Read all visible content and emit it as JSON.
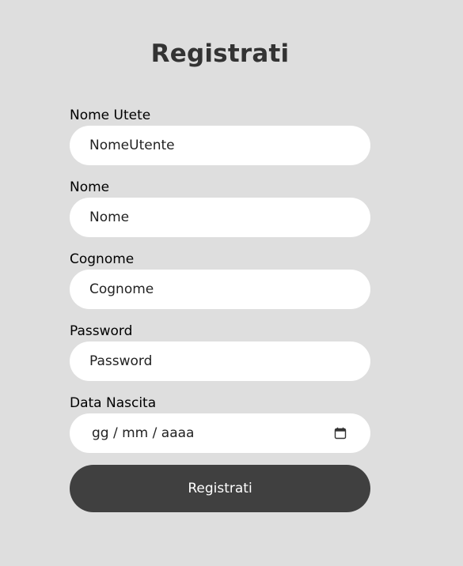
{
  "page": {
    "title": "Registrati"
  },
  "form": {
    "username": {
      "label": "Nome Utete",
      "placeholder": "NomeUtente"
    },
    "first_name": {
      "label": "Nome",
      "placeholder": "Nome"
    },
    "last_name": {
      "label": "Cognome",
      "placeholder": "Cognome"
    },
    "password": {
      "label": "Password",
      "placeholder": "Password"
    },
    "birth_date": {
      "label": "Data Nascita",
      "placeholder": "gg / mm / aaaa",
      "icon": "calendar-icon"
    },
    "submit_label": "Registrati"
  },
  "colors": {
    "background": "#dedede",
    "field_background": "#ffffff",
    "button_background": "#404040",
    "title_color": "#333333"
  }
}
